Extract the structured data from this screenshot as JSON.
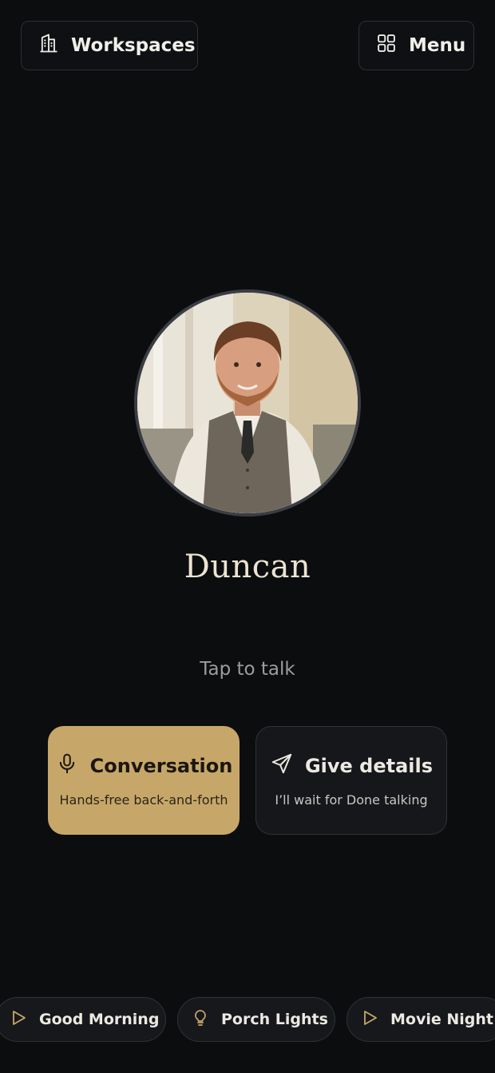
{
  "header": {
    "workspaces_label": "Workspaces",
    "menu_label": "Menu"
  },
  "profile": {
    "name": "Duncan",
    "prompt": "Tap to talk"
  },
  "modes": [
    {
      "title": "Conversation",
      "subtitle": "Hands-free back-and-forth",
      "icon": "microphone-icon",
      "active": true
    },
    {
      "title": "Give details",
      "subtitle": "I’ll wait for Done talking",
      "icon": "send-icon",
      "active": false
    }
  ],
  "quick_actions": [
    {
      "label": "Good Morning",
      "icon": "play-icon"
    },
    {
      "label": "Porch Lights",
      "icon": "lightbulb-icon"
    },
    {
      "label": "Movie Night",
      "icon": "play-icon"
    }
  ],
  "colors": {
    "background": "#0c0d0f",
    "accent": "#c7a769",
    "icon_gold": "#c7a769"
  }
}
